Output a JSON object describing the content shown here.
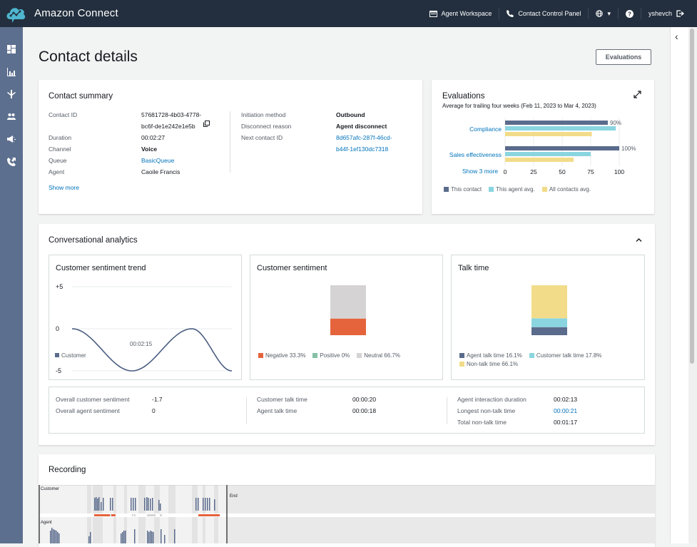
{
  "header": {
    "app_title": "Amazon Connect",
    "agent_workspace": "Agent Workspace",
    "contact_control_panel": "Contact Control Panel",
    "language_caret": "▾",
    "username": "yshevch"
  },
  "page": {
    "title": "Contact details",
    "evaluations_button": "Evaluations"
  },
  "contact_summary": {
    "title": "Contact summary",
    "left": [
      {
        "label": "Contact ID",
        "value_line1": "57681728-4b03-4778-",
        "value_line2": "bc6f-de1e242e1e5b"
      },
      {
        "label": "Duration",
        "value": "00:02:27"
      },
      {
        "label": "Channel",
        "value": "Voice"
      },
      {
        "label": "Queue",
        "value": "BasicQueue"
      },
      {
        "label": "Agent",
        "value": "Caoile Francis"
      }
    ],
    "right": [
      {
        "label": "Initiation method",
        "value": "Outbound"
      },
      {
        "label": "Disconnect reason",
        "value": "Agent disconnect"
      },
      {
        "label": "Next contact ID",
        "value_line1": "8d657afc-287f-46cd-",
        "value_line2": "b44f-1ef130dc7318"
      }
    ],
    "show_more": "Show more"
  },
  "evaluations": {
    "title": "Evaluations",
    "subtitle": "Average for trailing four weeks (Feb 11, 2023 to Mar 4, 2023)",
    "show_more": "Show 3 more"
  },
  "conversational_analytics": {
    "title": "Conversational analytics",
    "sentiment_trend": {
      "title": "Customer sentiment trend",
      "tooltip_time": "00:02:15",
      "legend": "Customer"
    },
    "customer_sentiment": {
      "title": "Customer sentiment"
    },
    "talk_time": {
      "title": "Talk time"
    },
    "stats": {
      "col1": [
        {
          "label": "Overall customer sentiment",
          "value": "-1.7"
        },
        {
          "label": "Overall agent sentiment",
          "value": "0"
        }
      ],
      "col2": [
        {
          "label": "Customer talk time",
          "value": "00:00:20"
        },
        {
          "label": "Agent talk time",
          "value": "00:00:18"
        }
      ],
      "col3": [
        {
          "label": "Agent interaction duration",
          "value": "00:02:13"
        },
        {
          "label": "Longest non-talk time",
          "value": "00:00:21"
        },
        {
          "label": "Total non-talk time",
          "value": "00:01:17"
        }
      ]
    }
  },
  "recording": {
    "title": "Recording",
    "customer_track": "Customer",
    "agent_track": "Agent",
    "end_label": "End"
  },
  "colors": {
    "navy": "#5a6b8c",
    "teal": "#8ad5e0",
    "yellow": "#f2dc8a",
    "orange": "#e5643c",
    "gray": "#d5d3d3",
    "green": "#86bfa6",
    "link": "#0073bb"
  },
  "chart_data": [
    {
      "type": "bar",
      "orientation": "horizontal",
      "title": "Evaluations",
      "categories": [
        "Compliance",
        "Sales effectiveness"
      ],
      "series": [
        {
          "name": "This contact",
          "values": [
            90,
            100
          ]
        },
        {
          "name": "This agent avg.",
          "values": [
            97,
            75
          ]
        },
        {
          "name": "All contacts avg.",
          "values": [
            76,
            60
          ]
        }
      ],
      "data_labels": [
        "90%",
        "100%"
      ],
      "xlim": [
        0,
        100
      ],
      "xticks": [
        "0",
        "25",
        "50",
        "75",
        "100"
      ],
      "legend": "bottom-left"
    },
    {
      "type": "line",
      "title": "Customer sentiment trend",
      "series": [
        {
          "name": "Customer",
          "x": [
            0,
            1,
            2,
            3,
            4
          ],
          "values": [
            0,
            -5,
            -2.5,
            0,
            -5
          ]
        }
      ],
      "ylim": [
        -5,
        5
      ],
      "yticks": [
        "+5",
        "0",
        "-5"
      ],
      "annotation": "00:02:15",
      "legend": "left"
    },
    {
      "type": "bar",
      "stacked": true,
      "title": "Customer sentiment",
      "series": [
        {
          "name": "Negative",
          "label": "Negative 33.3%",
          "value": 33.3
        },
        {
          "name": "Positive",
          "label": "Positive 0%",
          "value": 0
        },
        {
          "name": "Neutral",
          "label": "Neutral 66.7%",
          "value": 66.7
        }
      ],
      "legend": "bottom"
    },
    {
      "type": "bar",
      "stacked": true,
      "title": "Talk time",
      "series": [
        {
          "name": "Agent talk time",
          "label": "Agent talk time 16.1%",
          "value": 16.1
        },
        {
          "name": "Customer talk time",
          "label": "Customer talk time 17.8%",
          "value": 17.8
        },
        {
          "name": "Non-talk time",
          "label": "Non-talk time 66.1%",
          "value": 66.1
        }
      ],
      "legend": "bottom"
    }
  ]
}
